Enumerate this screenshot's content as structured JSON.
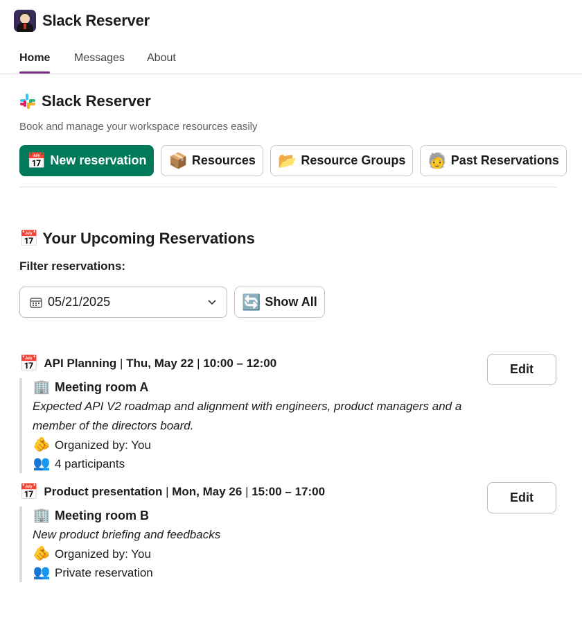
{
  "app": {
    "title": "Slack Reserver",
    "avatar_icon": "butler-avatar-icon"
  },
  "tabs": [
    {
      "label": "Home",
      "active": true
    },
    {
      "label": "Messages",
      "active": false
    },
    {
      "label": "About",
      "active": false
    }
  ],
  "home": {
    "title": "Slack Reserver",
    "subtitle": "Book and manage your workspace resources easily",
    "buttons": [
      {
        "label": "New reservation",
        "icon": "📅",
        "primary": true
      },
      {
        "label": "Resources",
        "icon": "📦"
      },
      {
        "label": "Resource Groups",
        "icon": "📂"
      },
      {
        "label": "Past Reservations",
        "icon": "🧓"
      }
    ]
  },
  "upcoming": {
    "icon": "📅",
    "title": "Your Upcoming Reservations",
    "filter_label": "Filter reservations:",
    "date_value": "05/21/2025",
    "show_all_icon": "🔄",
    "show_all_label": "Show All"
  },
  "reservations": [
    {
      "icon": "📅",
      "name": "API Planning",
      "sep1": " | ",
      "date": "Thu, May 22",
      "sep2": " | ",
      "time": "10:00 – 12:00",
      "room_icon": "🏢",
      "room": "Meeting room A",
      "description": "Expected API V2 roadmap and alignment with engineers, product managers and a member of the directors board.",
      "organizer_icon": "🫵",
      "organizer": "Organized by: You",
      "participants_icon": "👥",
      "participants": "4 participants",
      "edit_label": "Edit"
    },
    {
      "icon": "📅",
      "name": "Product presentation",
      "sep1": " | ",
      "date": "Mon, May 26",
      "sep2": " | ",
      "time": "15:00 – 17:00",
      "room_icon": "🏢",
      "room": "Meeting room B",
      "description": "New product briefing and feedbacks",
      "organizer_icon": "🫵",
      "organizer": "Organized by: You",
      "participants_icon": "👥",
      "participants": "Private reservation",
      "edit_label": "Edit"
    }
  ],
  "colors": {
    "primary": "#007a5a",
    "tab_accent": "#7c3085",
    "divider": "#dddddd"
  }
}
